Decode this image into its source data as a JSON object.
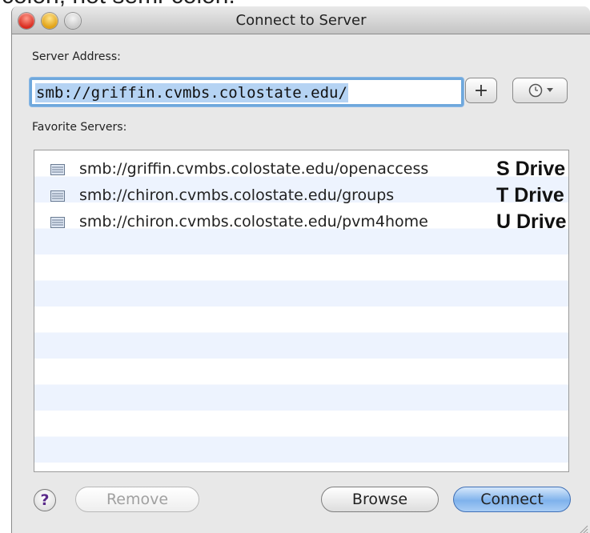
{
  "background_caption_fragment": "colon, not semi-colon.",
  "window": {
    "title": "Connect to Server"
  },
  "server_address": {
    "label": "Server Address:",
    "value": "smb://griffin.cvmbs.colostate.edu/"
  },
  "buttons": {
    "add_favorite": "+",
    "recent_servers_icon": "clock-icon",
    "help": "?",
    "remove": "Remove",
    "browse": "Browse",
    "connect": "Connect"
  },
  "favorites": {
    "label": "Favorite Servers:",
    "items": [
      {
        "url": "smb://griffin.cvmbs.colostate.edu/openaccess",
        "drive": "S Drive"
      },
      {
        "url": "smb://chiron.cvmbs.colostate.edu/groups",
        "drive": "T Drive"
      },
      {
        "url": "smb://chiron.cvmbs.colostate.edu/pvm4home",
        "drive": "U Drive"
      }
    ]
  },
  "colors": {
    "accent": "#6fa8dc",
    "selection": "#b5d3f3",
    "stripe": "#edf3fe",
    "connect_button": "#7fb2ec"
  }
}
